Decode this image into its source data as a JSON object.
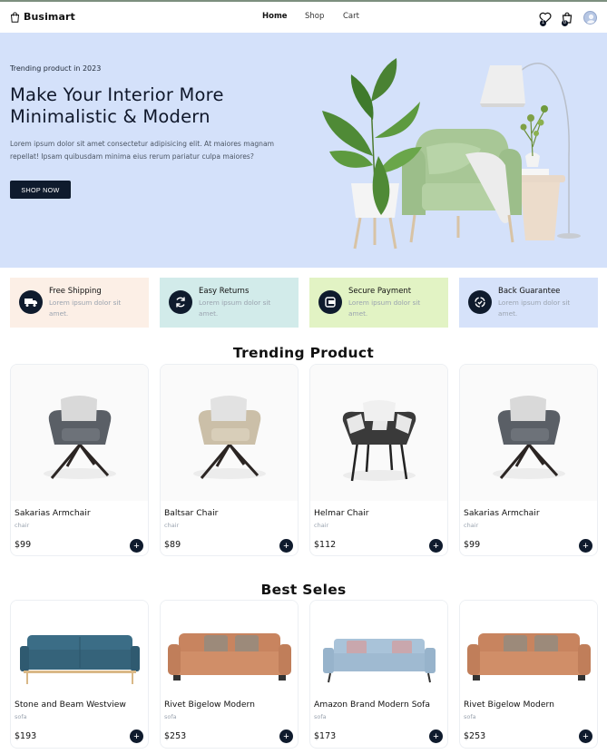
{
  "brand": {
    "name": "Busimart",
    "icon": "shopping-bag-icon"
  },
  "nav": {
    "links": [
      {
        "label": "Home",
        "active": true
      },
      {
        "label": "Shop",
        "active": false
      },
      {
        "label": "Cart",
        "active": false
      }
    ],
    "wishlist_count": "1",
    "cart_count": "0"
  },
  "hero": {
    "tag": "Trending product in 2023",
    "title": "Make Your Interior More Minimalistic & Modern",
    "description": "Lorem ipsum dolor sit amet consectetur adipisicing elit. At maiores magnam repellat! Ipsam quibusdam minima eius rerum pariatur culpa maiores?",
    "button": "SHOP NOW",
    "background": "#d4e1fa"
  },
  "features": [
    {
      "title": "Free Shipping",
      "desc": "Lorem ipsum dolor sit amet.",
      "bg": "#fcefe6",
      "icon": "truck-icon"
    },
    {
      "title": "Easy Returns",
      "desc": "Lorem ipsum dolor sit amet.",
      "bg": "#d2ebea",
      "icon": "refresh-icon"
    },
    {
      "title": "Secure Payment",
      "desc": "Lorem ipsum dolor sit amet.",
      "bg": "#e2f3c4",
      "icon": "payment-icon"
    },
    {
      "title": "Back Guarantee",
      "desc": "Lorem ipsum dolor sit amet.",
      "bg": "#d6e2fa",
      "icon": "guarantee-icon"
    }
  ],
  "trending": {
    "title": "Trending Product",
    "items": [
      {
        "name": "Sakarias Armchair",
        "category": "chair",
        "price": "$99"
      },
      {
        "name": "Baltsar Chair",
        "category": "chair",
        "price": "$89"
      },
      {
        "name": "Helmar Chair",
        "category": "chair",
        "price": "$112"
      },
      {
        "name": "Sakarias Armchair",
        "category": "chair",
        "price": "$99"
      }
    ]
  },
  "best": {
    "title": "Best Seles",
    "items": [
      {
        "name": "Stone and Beam Westview",
        "category": "sofa",
        "price": "$193"
      },
      {
        "name": "Rivet Bigelow Modern",
        "category": "sofa",
        "price": "$253"
      },
      {
        "name": "Amazon Brand Modern Sofa",
        "category": "sofa",
        "price": "$173"
      },
      {
        "name": "Rivet Bigelow Modern",
        "category": "sofa",
        "price": "$253"
      }
    ]
  },
  "colors": {
    "accent": "#0f1b2d"
  }
}
